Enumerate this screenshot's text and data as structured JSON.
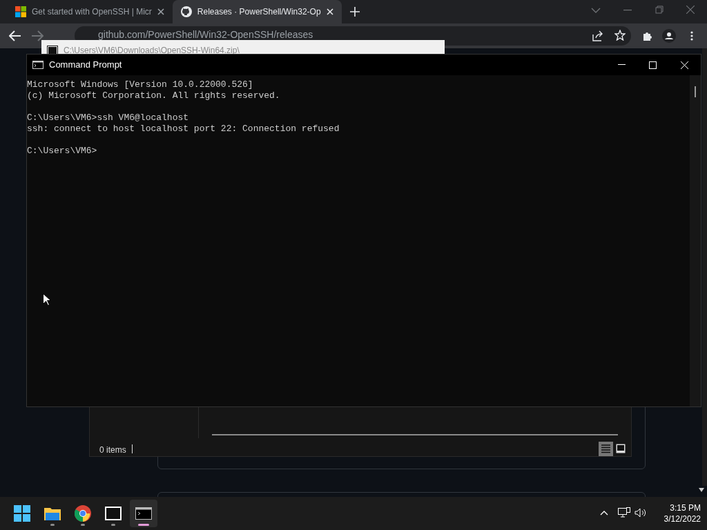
{
  "browser": {
    "tabs": [
      {
        "title": "Get started with OpenSSH | Micr",
        "kind": "ms",
        "selected": false
      },
      {
        "title": "Releases · PowerShell/Win32-Op",
        "kind": "gh",
        "selected": true
      }
    ],
    "url": "github.com/PowerShell/Win32-OpenSSH/releases"
  },
  "archive_window": {
    "title": "C:\\Users\\VM6\\Downloads\\OpenSSH-Win64.zip\\",
    "status": "0 items"
  },
  "command_prompt": {
    "title": "Command Prompt",
    "blocks": [
      [
        "Microsoft Windows [Version 10.0.22000.526]",
        "(c) Microsoft Corporation. All rights reserved."
      ],
      [
        "C:\\Users\\VM6>ssh VM6@localhost",
        "ssh: connect to host localhost port 22: Connection refused"
      ],
      [
        "C:\\Users\\VM6>"
      ]
    ]
  },
  "taskbar": {
    "apps": [
      {
        "kind": "start",
        "selected": false
      },
      {
        "kind": "folder",
        "selected": false
      },
      {
        "kind": "browser",
        "selected": false
      },
      {
        "kind": "archiver",
        "selected": false
      },
      {
        "kind": "terminal",
        "selected": true
      }
    ],
    "time": "3:15 PM",
    "date": "3/12/2022"
  }
}
